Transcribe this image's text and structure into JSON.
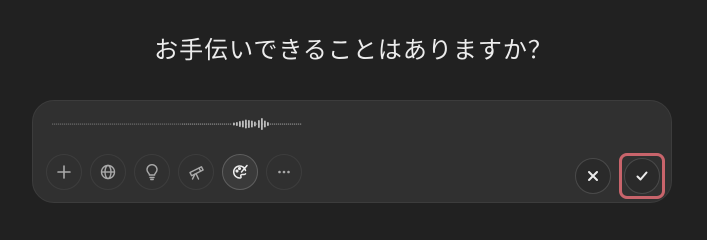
{
  "prompt": {
    "heading": "お手伝いできることはありますか？"
  },
  "composer": {
    "voice_mode": "dictation",
    "tools": [
      {
        "icon": "plus-icon"
      },
      {
        "icon": "globe-icon"
      },
      {
        "icon": "lightbulb-icon"
      },
      {
        "icon": "telescope-icon"
      },
      {
        "icon": "paint-palette-icon",
        "active": true
      },
      {
        "icon": "more-horizontal-icon"
      }
    ],
    "actions": {
      "cancel_icon": "close-icon",
      "confirm_icon": "checkmark-icon"
    },
    "highlight_color": "#c8646b"
  }
}
